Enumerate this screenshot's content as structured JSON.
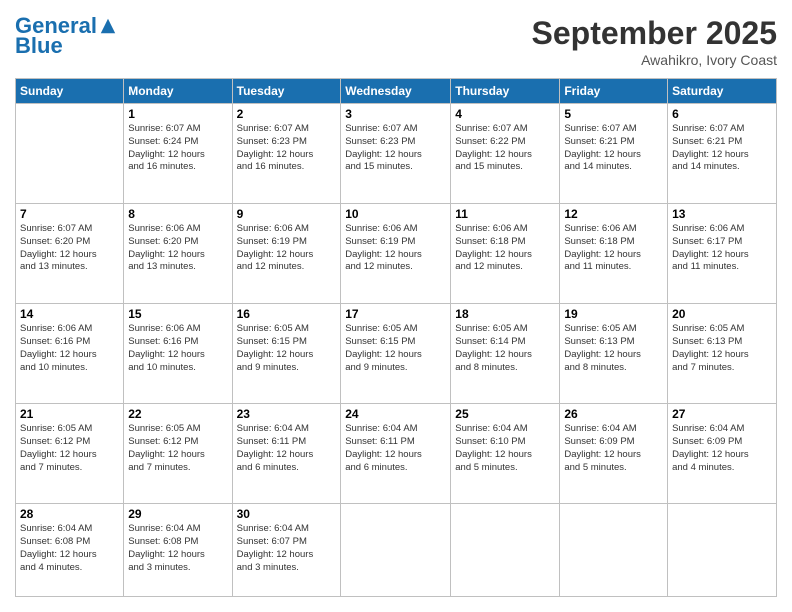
{
  "header": {
    "logo_general": "General",
    "logo_blue": "Blue",
    "month_title": "September 2025",
    "location": "Awahikro, Ivory Coast"
  },
  "days_of_week": [
    "Sunday",
    "Monday",
    "Tuesday",
    "Wednesday",
    "Thursday",
    "Friday",
    "Saturday"
  ],
  "weeks": [
    [
      {
        "day": "",
        "info": ""
      },
      {
        "day": "1",
        "info": "Sunrise: 6:07 AM\nSunset: 6:24 PM\nDaylight: 12 hours\nand 16 minutes."
      },
      {
        "day": "2",
        "info": "Sunrise: 6:07 AM\nSunset: 6:23 PM\nDaylight: 12 hours\nand 16 minutes."
      },
      {
        "day": "3",
        "info": "Sunrise: 6:07 AM\nSunset: 6:23 PM\nDaylight: 12 hours\nand 15 minutes."
      },
      {
        "day": "4",
        "info": "Sunrise: 6:07 AM\nSunset: 6:22 PM\nDaylight: 12 hours\nand 15 minutes."
      },
      {
        "day": "5",
        "info": "Sunrise: 6:07 AM\nSunset: 6:21 PM\nDaylight: 12 hours\nand 14 minutes."
      },
      {
        "day": "6",
        "info": "Sunrise: 6:07 AM\nSunset: 6:21 PM\nDaylight: 12 hours\nand 14 minutes."
      }
    ],
    [
      {
        "day": "7",
        "info": "Sunrise: 6:07 AM\nSunset: 6:20 PM\nDaylight: 12 hours\nand 13 minutes."
      },
      {
        "day": "8",
        "info": "Sunrise: 6:06 AM\nSunset: 6:20 PM\nDaylight: 12 hours\nand 13 minutes."
      },
      {
        "day": "9",
        "info": "Sunrise: 6:06 AM\nSunset: 6:19 PM\nDaylight: 12 hours\nand 12 minutes."
      },
      {
        "day": "10",
        "info": "Sunrise: 6:06 AM\nSunset: 6:19 PM\nDaylight: 12 hours\nand 12 minutes."
      },
      {
        "day": "11",
        "info": "Sunrise: 6:06 AM\nSunset: 6:18 PM\nDaylight: 12 hours\nand 12 minutes."
      },
      {
        "day": "12",
        "info": "Sunrise: 6:06 AM\nSunset: 6:18 PM\nDaylight: 12 hours\nand 11 minutes."
      },
      {
        "day": "13",
        "info": "Sunrise: 6:06 AM\nSunset: 6:17 PM\nDaylight: 12 hours\nand 11 minutes."
      }
    ],
    [
      {
        "day": "14",
        "info": "Sunrise: 6:06 AM\nSunset: 6:16 PM\nDaylight: 12 hours\nand 10 minutes."
      },
      {
        "day": "15",
        "info": "Sunrise: 6:06 AM\nSunset: 6:16 PM\nDaylight: 12 hours\nand 10 minutes."
      },
      {
        "day": "16",
        "info": "Sunrise: 6:05 AM\nSunset: 6:15 PM\nDaylight: 12 hours\nand 9 minutes."
      },
      {
        "day": "17",
        "info": "Sunrise: 6:05 AM\nSunset: 6:15 PM\nDaylight: 12 hours\nand 9 minutes."
      },
      {
        "day": "18",
        "info": "Sunrise: 6:05 AM\nSunset: 6:14 PM\nDaylight: 12 hours\nand 8 minutes."
      },
      {
        "day": "19",
        "info": "Sunrise: 6:05 AM\nSunset: 6:13 PM\nDaylight: 12 hours\nand 8 minutes."
      },
      {
        "day": "20",
        "info": "Sunrise: 6:05 AM\nSunset: 6:13 PM\nDaylight: 12 hours\nand 7 minutes."
      }
    ],
    [
      {
        "day": "21",
        "info": "Sunrise: 6:05 AM\nSunset: 6:12 PM\nDaylight: 12 hours\nand 7 minutes."
      },
      {
        "day": "22",
        "info": "Sunrise: 6:05 AM\nSunset: 6:12 PM\nDaylight: 12 hours\nand 7 minutes."
      },
      {
        "day": "23",
        "info": "Sunrise: 6:04 AM\nSunset: 6:11 PM\nDaylight: 12 hours\nand 6 minutes."
      },
      {
        "day": "24",
        "info": "Sunrise: 6:04 AM\nSunset: 6:11 PM\nDaylight: 12 hours\nand 6 minutes."
      },
      {
        "day": "25",
        "info": "Sunrise: 6:04 AM\nSunset: 6:10 PM\nDaylight: 12 hours\nand 5 minutes."
      },
      {
        "day": "26",
        "info": "Sunrise: 6:04 AM\nSunset: 6:09 PM\nDaylight: 12 hours\nand 5 minutes."
      },
      {
        "day": "27",
        "info": "Sunrise: 6:04 AM\nSunset: 6:09 PM\nDaylight: 12 hours\nand 4 minutes."
      }
    ],
    [
      {
        "day": "28",
        "info": "Sunrise: 6:04 AM\nSunset: 6:08 PM\nDaylight: 12 hours\nand 4 minutes."
      },
      {
        "day": "29",
        "info": "Sunrise: 6:04 AM\nSunset: 6:08 PM\nDaylight: 12 hours\nand 3 minutes."
      },
      {
        "day": "30",
        "info": "Sunrise: 6:04 AM\nSunset: 6:07 PM\nDaylight: 12 hours\nand 3 minutes."
      },
      {
        "day": "",
        "info": ""
      },
      {
        "day": "",
        "info": ""
      },
      {
        "day": "",
        "info": ""
      },
      {
        "day": "",
        "info": ""
      }
    ]
  ]
}
